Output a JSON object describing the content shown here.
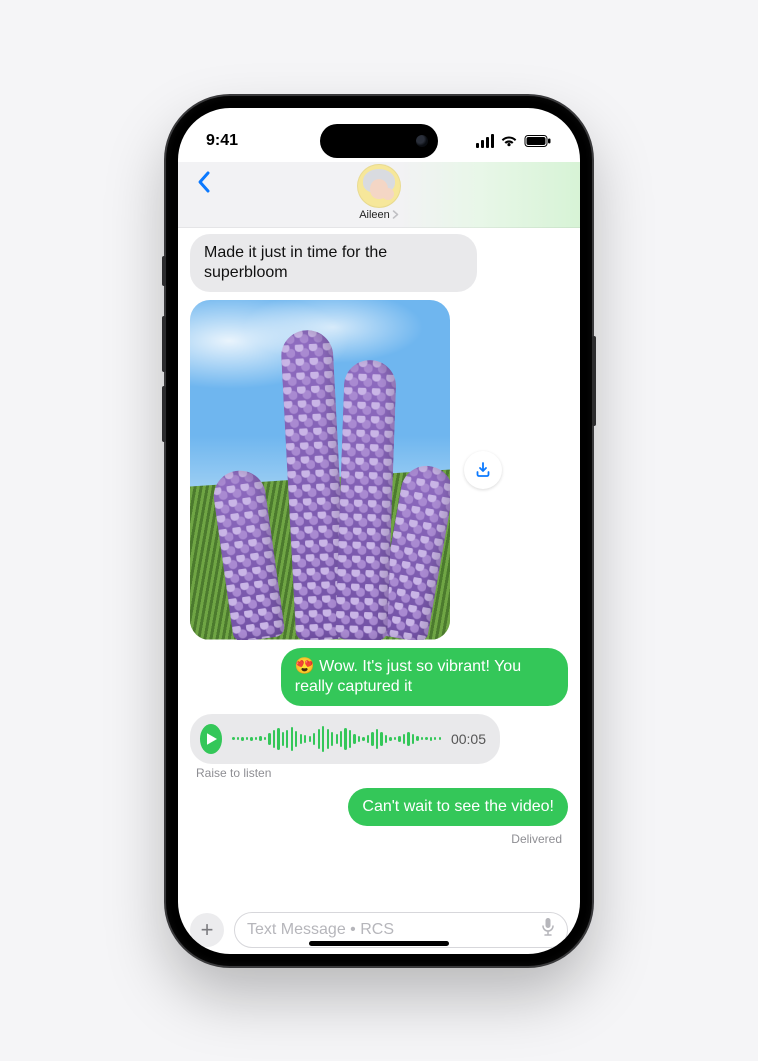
{
  "status": {
    "time": "9:41"
  },
  "header": {
    "contact_name": "Aileen",
    "back_icon": "chevron-left",
    "avatar_alt": "Memoji avatar"
  },
  "messages": {
    "incoming_text_1": "Made it just in time for the superbloom",
    "image_alt": "Photo of purple lavender superbloom under a blue sky",
    "download_icon": "download",
    "outgoing_text_1_emoji": "😍",
    "outgoing_text_1": "Wow. It's just so vibrant! You really captured it",
    "audio": {
      "duration": "00:05",
      "hint": "Raise to listen"
    },
    "outgoing_text_2": "Can't wait to see the video!",
    "delivery_status": "Delivered"
  },
  "composer": {
    "placeholder": "Text Message • RCS",
    "plus_label": "+",
    "mic_icon": "microphone"
  },
  "colors": {
    "accent_blue": "#0b79ff",
    "bubble_green": "#34c759",
    "bubble_gray": "#e9e9eb"
  }
}
